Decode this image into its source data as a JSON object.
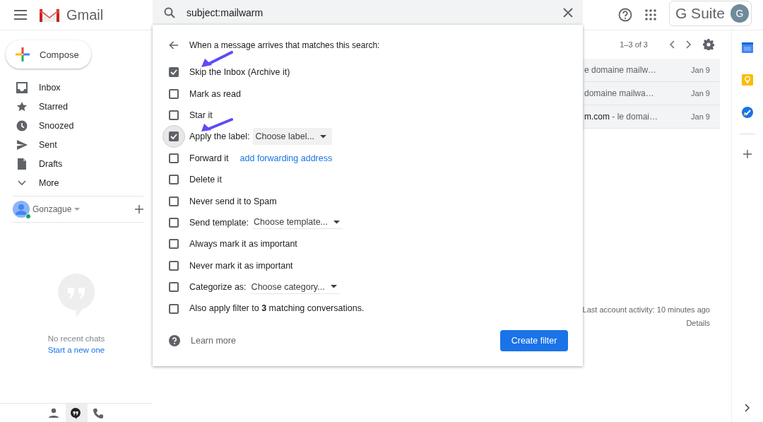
{
  "header": {
    "app_name": "Gmail",
    "search": {
      "value": "subject:mailwarm"
    },
    "brand": "G Suite",
    "avatar_initial": "G"
  },
  "sidebar": {
    "compose": "Compose",
    "items": [
      {
        "label": "Inbox",
        "selected": false
      },
      {
        "label": "Starred",
        "selected": false
      },
      {
        "label": "Snoozed",
        "selected": false
      },
      {
        "label": "Sent",
        "selected": false
      },
      {
        "label": "Drafts",
        "selected": false
      },
      {
        "label": "More",
        "selected": false
      }
    ],
    "account": {
      "name": "Gonzague",
      "online": true
    },
    "chat": {
      "empty_text": "No recent chats",
      "link": "Start a new one"
    },
    "chat_tabs": [
      {
        "kind": "people",
        "selected": false
      },
      {
        "kind": "hangouts",
        "selected": true
      },
      {
        "kind": "phone",
        "selected": false
      }
    ]
  },
  "toolbar": {
    "range": "1–3 of 3"
  },
  "emails": [
    {
      "snippet": "e domaine mailw…",
      "date": "Jan 9"
    },
    {
      "snippet": "domaine mailwa…",
      "date": "Jan 9"
    },
    {
      "snippet": "**m.com** - le domai…",
      "date": "Jan 9"
    }
  ],
  "footer": {
    "activity": "Last account activity: 10 minutes ago",
    "details": "Details"
  },
  "filter_dialog": {
    "heading": "When a message arrives that matches this search:",
    "options": [
      {
        "label": "Skip the Inbox (Archive it)",
        "checked": true,
        "focused": false
      },
      {
        "label": "Mark as read",
        "checked": false,
        "focused": false
      },
      {
        "label": "Star it",
        "checked": false,
        "focused": false
      },
      {
        "label": "Apply the label:",
        "checked": true,
        "focused": true,
        "dropdown": {
          "kind": "filled",
          "text": "Choose label..."
        }
      },
      {
        "label": "Forward it",
        "checked": false,
        "focused": false,
        "link": "add forwarding address"
      },
      {
        "label": "Delete it",
        "checked": false,
        "focused": false
      },
      {
        "label": "Never send it to Spam",
        "checked": false,
        "focused": false
      },
      {
        "label": "Send template:",
        "checked": false,
        "focused": false,
        "dropdown": {
          "kind": "underlined",
          "text": "Choose template..."
        }
      },
      {
        "label": "Always mark it as important",
        "checked": false,
        "focused": false
      },
      {
        "label": "Never mark it as important",
        "checked": false,
        "focused": false
      },
      {
        "label": "Categorize as:",
        "checked": false,
        "focused": false,
        "dropdown": {
          "kind": "underlined",
          "text": "Choose category..."
        }
      },
      {
        "label": "Also apply filter to **3** matching conversations.",
        "checked": false,
        "focused": false
      }
    ],
    "annotations": [
      {
        "kind": "arrow"
      },
      {
        "kind": "arrow"
      }
    ],
    "learn_more": "Learn more",
    "create_button": "Create filter"
  }
}
